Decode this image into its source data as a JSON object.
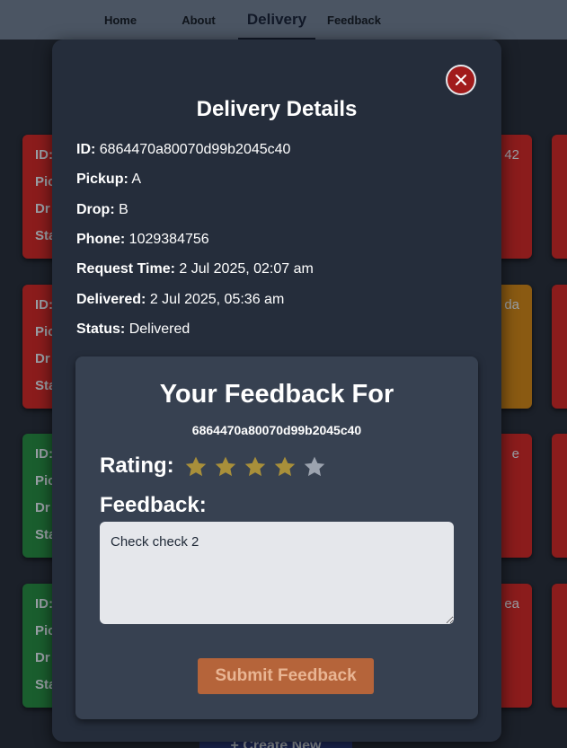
{
  "nav": {
    "items": [
      {
        "label": "Home",
        "active": false
      },
      {
        "label": "About",
        "active": false
      },
      {
        "label": "Delivery",
        "active": true
      },
      {
        "label": "Feedback",
        "active": false
      }
    ]
  },
  "background": {
    "row_labels": [
      "ID:",
      "Pic",
      "Dr",
      "Sta"
    ],
    "right_fragments": [
      "42",
      "da",
      "e",
      "ea"
    ],
    "create_button": "+ Create New"
  },
  "modal": {
    "close_icon": "close-icon",
    "title": "Delivery Details",
    "details": [
      {
        "label": "ID:",
        "value": "6864470a80070d99b2045c40"
      },
      {
        "label": "Pickup:",
        "value": "A"
      },
      {
        "label": "Drop:",
        "value": "B"
      },
      {
        "label": "Phone:",
        "value": "1029384756"
      },
      {
        "label": "Request Time:",
        "value": "2 Jul 2025, 02:07 am"
      },
      {
        "label": "Delivered:",
        "value": "2 Jul 2025, 05:36 am"
      },
      {
        "label": "Status:",
        "value": "Delivered"
      }
    ],
    "feedback": {
      "title": "Your Feedback For",
      "delivery_id": "6864470a80070d99b2045c40",
      "rating_label": "Rating:",
      "rating": 4,
      "max_rating": 5,
      "feedback_label": "Feedback:",
      "feedback_text": "Check check 2",
      "submit_label": "Submit Feedback"
    }
  },
  "colors": {
    "star_filled": "#a88f3a",
    "star_empty": "#9ca3af",
    "card_red": "#8b1c1c",
    "card_green": "#1a5e2e",
    "card_orange": "#8a5a12"
  }
}
